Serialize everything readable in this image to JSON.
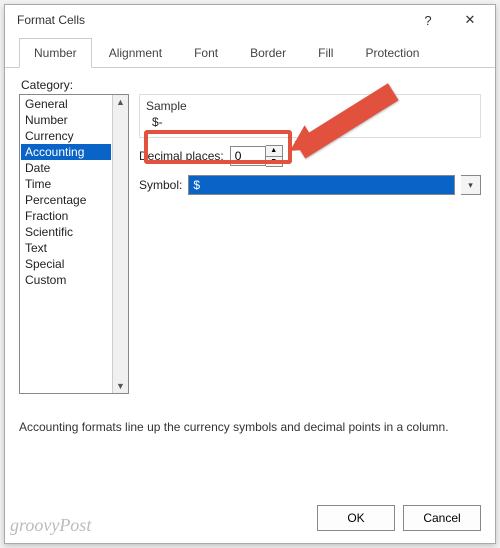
{
  "window": {
    "title": "Format Cells",
    "help": "?",
    "close": "✕"
  },
  "tabs": [
    "Number",
    "Alignment",
    "Font",
    "Border",
    "Fill",
    "Protection"
  ],
  "activeTab": 0,
  "categoryLabel": "Category:",
  "categories": [
    "General",
    "Number",
    "Currency",
    "Accounting",
    "Date",
    "Time",
    "Percentage",
    "Fraction",
    "Scientific",
    "Text",
    "Special",
    "Custom"
  ],
  "selectedCategory": 3,
  "sample": {
    "label": "Sample",
    "value": "$-"
  },
  "decimal": {
    "label": "Decimal places:",
    "value": "0"
  },
  "symbol": {
    "label": "Symbol:",
    "value": "$"
  },
  "description": "Accounting formats line up the currency symbols and decimal points in a column.",
  "buttons": {
    "ok": "OK",
    "cancel": "Cancel"
  },
  "watermark": "groovyPost"
}
